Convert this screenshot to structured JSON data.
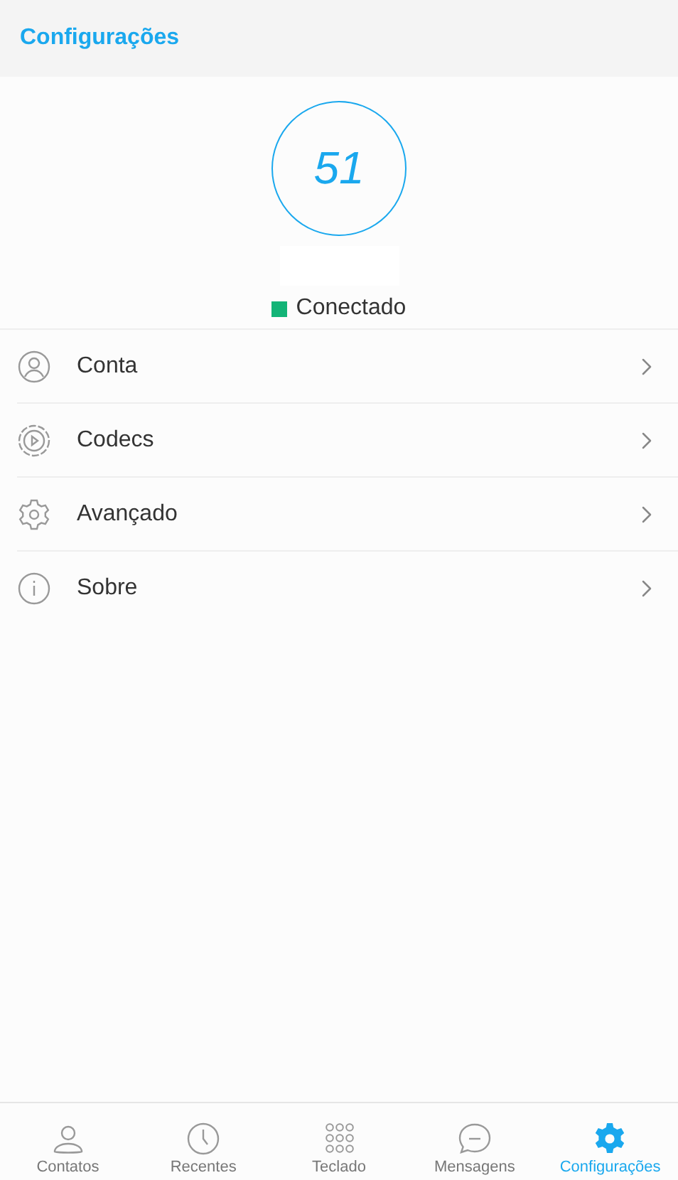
{
  "header": {
    "title": "Configurações"
  },
  "account": {
    "extension": "51",
    "status": {
      "label": "Conectado",
      "connected": true
    }
  },
  "menu": [
    {
      "label": "Conta"
    },
    {
      "label": "Codecs"
    },
    {
      "label": "Avançado"
    },
    {
      "label": "Sobre"
    }
  ],
  "nav": [
    {
      "label": "Contatos",
      "selected": false
    },
    {
      "label": "Recentes",
      "selected": false
    },
    {
      "label": "Teclado",
      "selected": false
    },
    {
      "label": "Mensagens",
      "selected": false
    },
    {
      "label": "Configurações",
      "selected": true
    }
  ]
}
